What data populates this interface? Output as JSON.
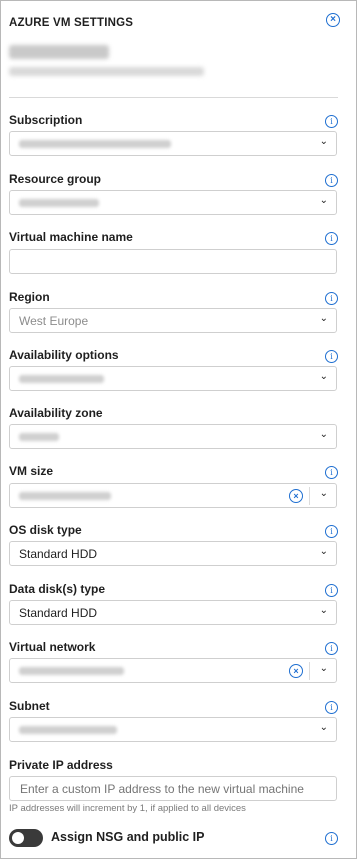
{
  "panel": {
    "title": "AZURE VM SETTINGS"
  },
  "fields": [
    {
      "key": "subscription",
      "label": "Subscription",
      "type": "select",
      "value": ""
    },
    {
      "key": "resource_group",
      "label": "Resource group",
      "type": "select",
      "value": ""
    },
    {
      "key": "vm_name",
      "label": "Virtual machine name",
      "type": "text",
      "value": ""
    },
    {
      "key": "region",
      "label": "Region",
      "type": "select",
      "value": "West Europe",
      "muted": true
    },
    {
      "key": "availability_options",
      "label": "Availability options",
      "type": "select",
      "value": ""
    },
    {
      "key": "availability_zone",
      "label": "Availability zone",
      "type": "select",
      "value": ""
    },
    {
      "key": "vm_size",
      "label": "VM size",
      "type": "select-clear",
      "value": ""
    },
    {
      "key": "os_disk_type",
      "label": "OS disk type",
      "type": "select",
      "value": "Standard HDD"
    },
    {
      "key": "data_disk_type",
      "label": "Data disk(s) type",
      "type": "select",
      "value": "Standard HDD"
    },
    {
      "key": "virtual_network",
      "label": "Virtual network",
      "type": "select-clear",
      "value": ""
    },
    {
      "key": "subnet",
      "label": "Subnet",
      "type": "select",
      "value": ""
    },
    {
      "key": "private_ip",
      "label": "Private IP address",
      "type": "text",
      "placeholder": "Enter a custom IP address to the new virtual machine",
      "helper": "IP addresses will increment by 1, if applied to all devices"
    }
  ],
  "nsg_toggle": {
    "label": "Assign NSG and public IP",
    "on": false
  },
  "icons": {
    "close": "close-circle-icon",
    "info": "info-icon",
    "chevron": "chevron-down-icon",
    "clear": "clear-circle-icon"
  },
  "colors": {
    "accent": "#1f6fd1",
    "toggle_off": "#3a3a3a",
    "border": "#cfcfcf"
  }
}
